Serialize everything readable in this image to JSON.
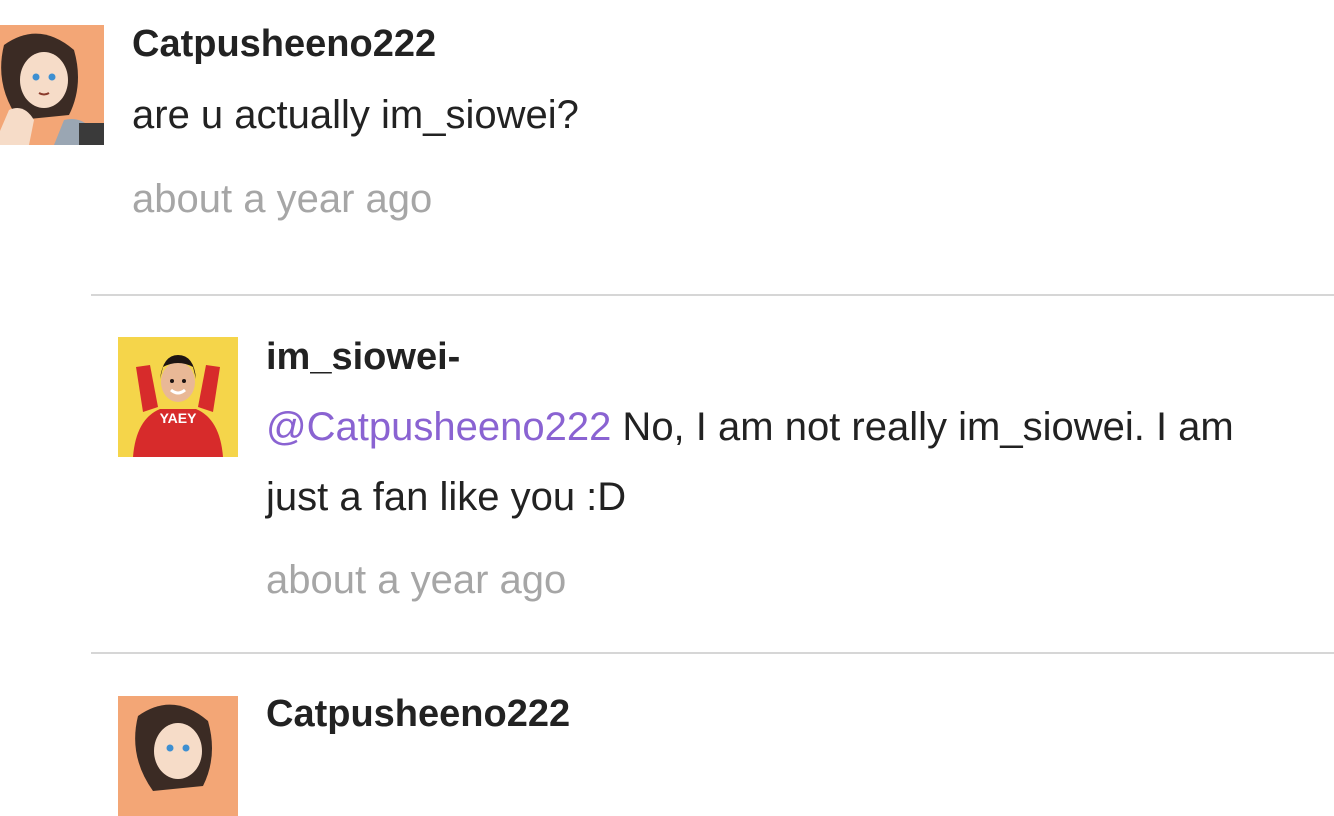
{
  "comments": [
    {
      "username": "Catpusheeno222",
      "text": "are u actually im_siowei?",
      "timestamp": "about a year ago",
      "avatar_icon": "anime-girl-avatar"
    },
    {
      "username": "im_siowei-",
      "mention": "@Catpusheeno222",
      "text": " No, I am not really im_siowei. I am just a fan like you :D",
      "timestamp": "about a year ago",
      "avatar_icon": "girl-red-sweater-avatar",
      "avatar_shirt_text": "YAEY"
    },
    {
      "username": "Catpusheeno222",
      "avatar_icon": "anime-girl-avatar"
    }
  ],
  "colors": {
    "mention": "#8a63d2",
    "timestamp": "#a6a6a6",
    "divider": "#d6d6d6",
    "avatar1_bg": "#f3a676",
    "avatar2_bg": "#f5d54a",
    "sweater": "#d72b2b"
  }
}
